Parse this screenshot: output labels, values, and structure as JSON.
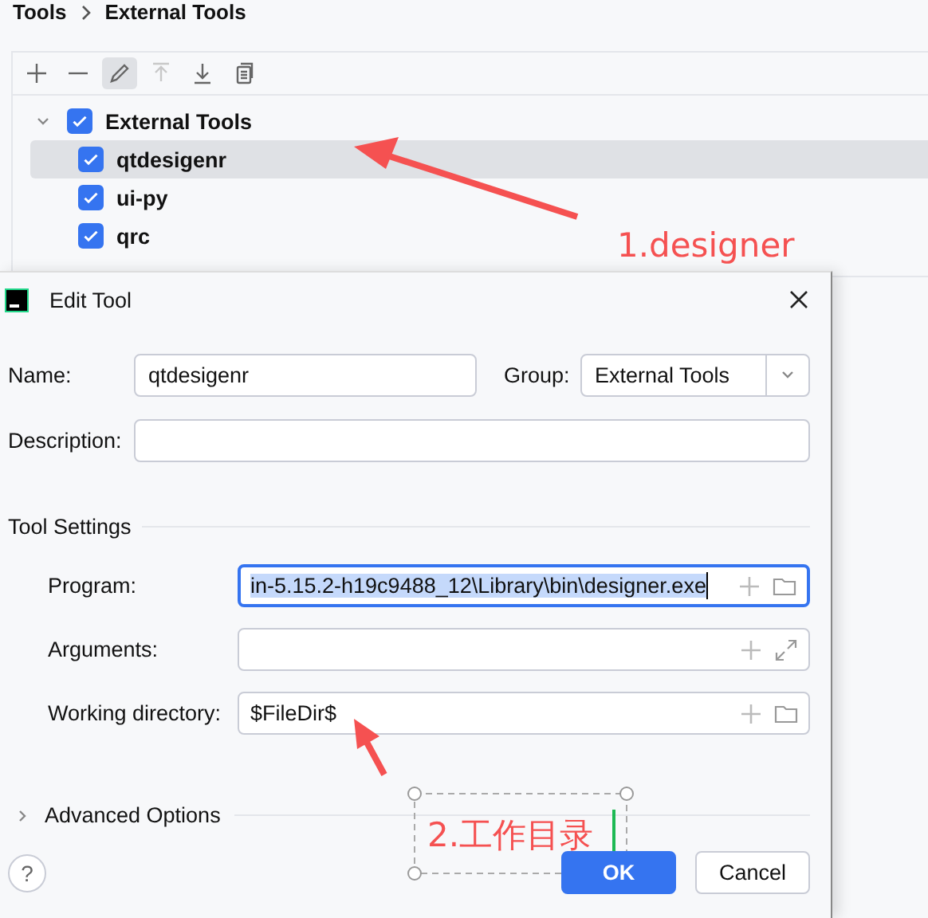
{
  "breadcrumb": [
    "Tools",
    "External Tools"
  ],
  "toolbar": [
    {
      "kind": "add",
      "disabled": false,
      "selected": false
    },
    {
      "kind": "remove",
      "disabled": false,
      "selected": false
    },
    {
      "kind": "edit",
      "disabled": false,
      "selected": true
    },
    {
      "kind": "move-up",
      "disabled": true,
      "selected": false
    },
    {
      "kind": "move-down",
      "disabled": false,
      "selected": false
    },
    {
      "kind": "copy",
      "disabled": false,
      "selected": false
    }
  ],
  "tree": {
    "label": "External Tools",
    "checked": true,
    "expanded": true,
    "children": [
      {
        "label": "qtdesigenr",
        "checked": true,
        "selected": true
      },
      {
        "label": "ui-py",
        "checked": true,
        "selected": false
      },
      {
        "label": "qrc",
        "checked": true,
        "selected": false
      }
    ]
  },
  "dialog": {
    "title": "Edit Tool",
    "name": {
      "label": "Name:",
      "value": "qtdesigenr"
    },
    "group": {
      "label": "Group:",
      "value": "External Tools"
    },
    "description": {
      "label": "Description:"
    },
    "section": "Tool Settings",
    "settings": [
      {
        "label": "Program:",
        "value": "in-5.15.2-h19c9488_12\\Library\\bin\\designer.exe",
        "kind": "path",
        "focused": true
      },
      {
        "label": "Arguments:",
        "kind": "text",
        "focused": false
      },
      {
        "label": "Working directory:",
        "value": "$FileDir$",
        "kind": "path",
        "focused": false
      }
    ],
    "advanced": {
      "label": "Advanced Options",
      "expanded": false
    },
    "help": "?",
    "buttons": [
      {
        "label": "OK",
        "kind": "primary"
      },
      {
        "label": "Cancel",
        "kind": "secondary"
      }
    ]
  },
  "annotations": [
    {
      "text": "1.designer"
    },
    {
      "text": "2.工作目录"
    }
  ]
}
